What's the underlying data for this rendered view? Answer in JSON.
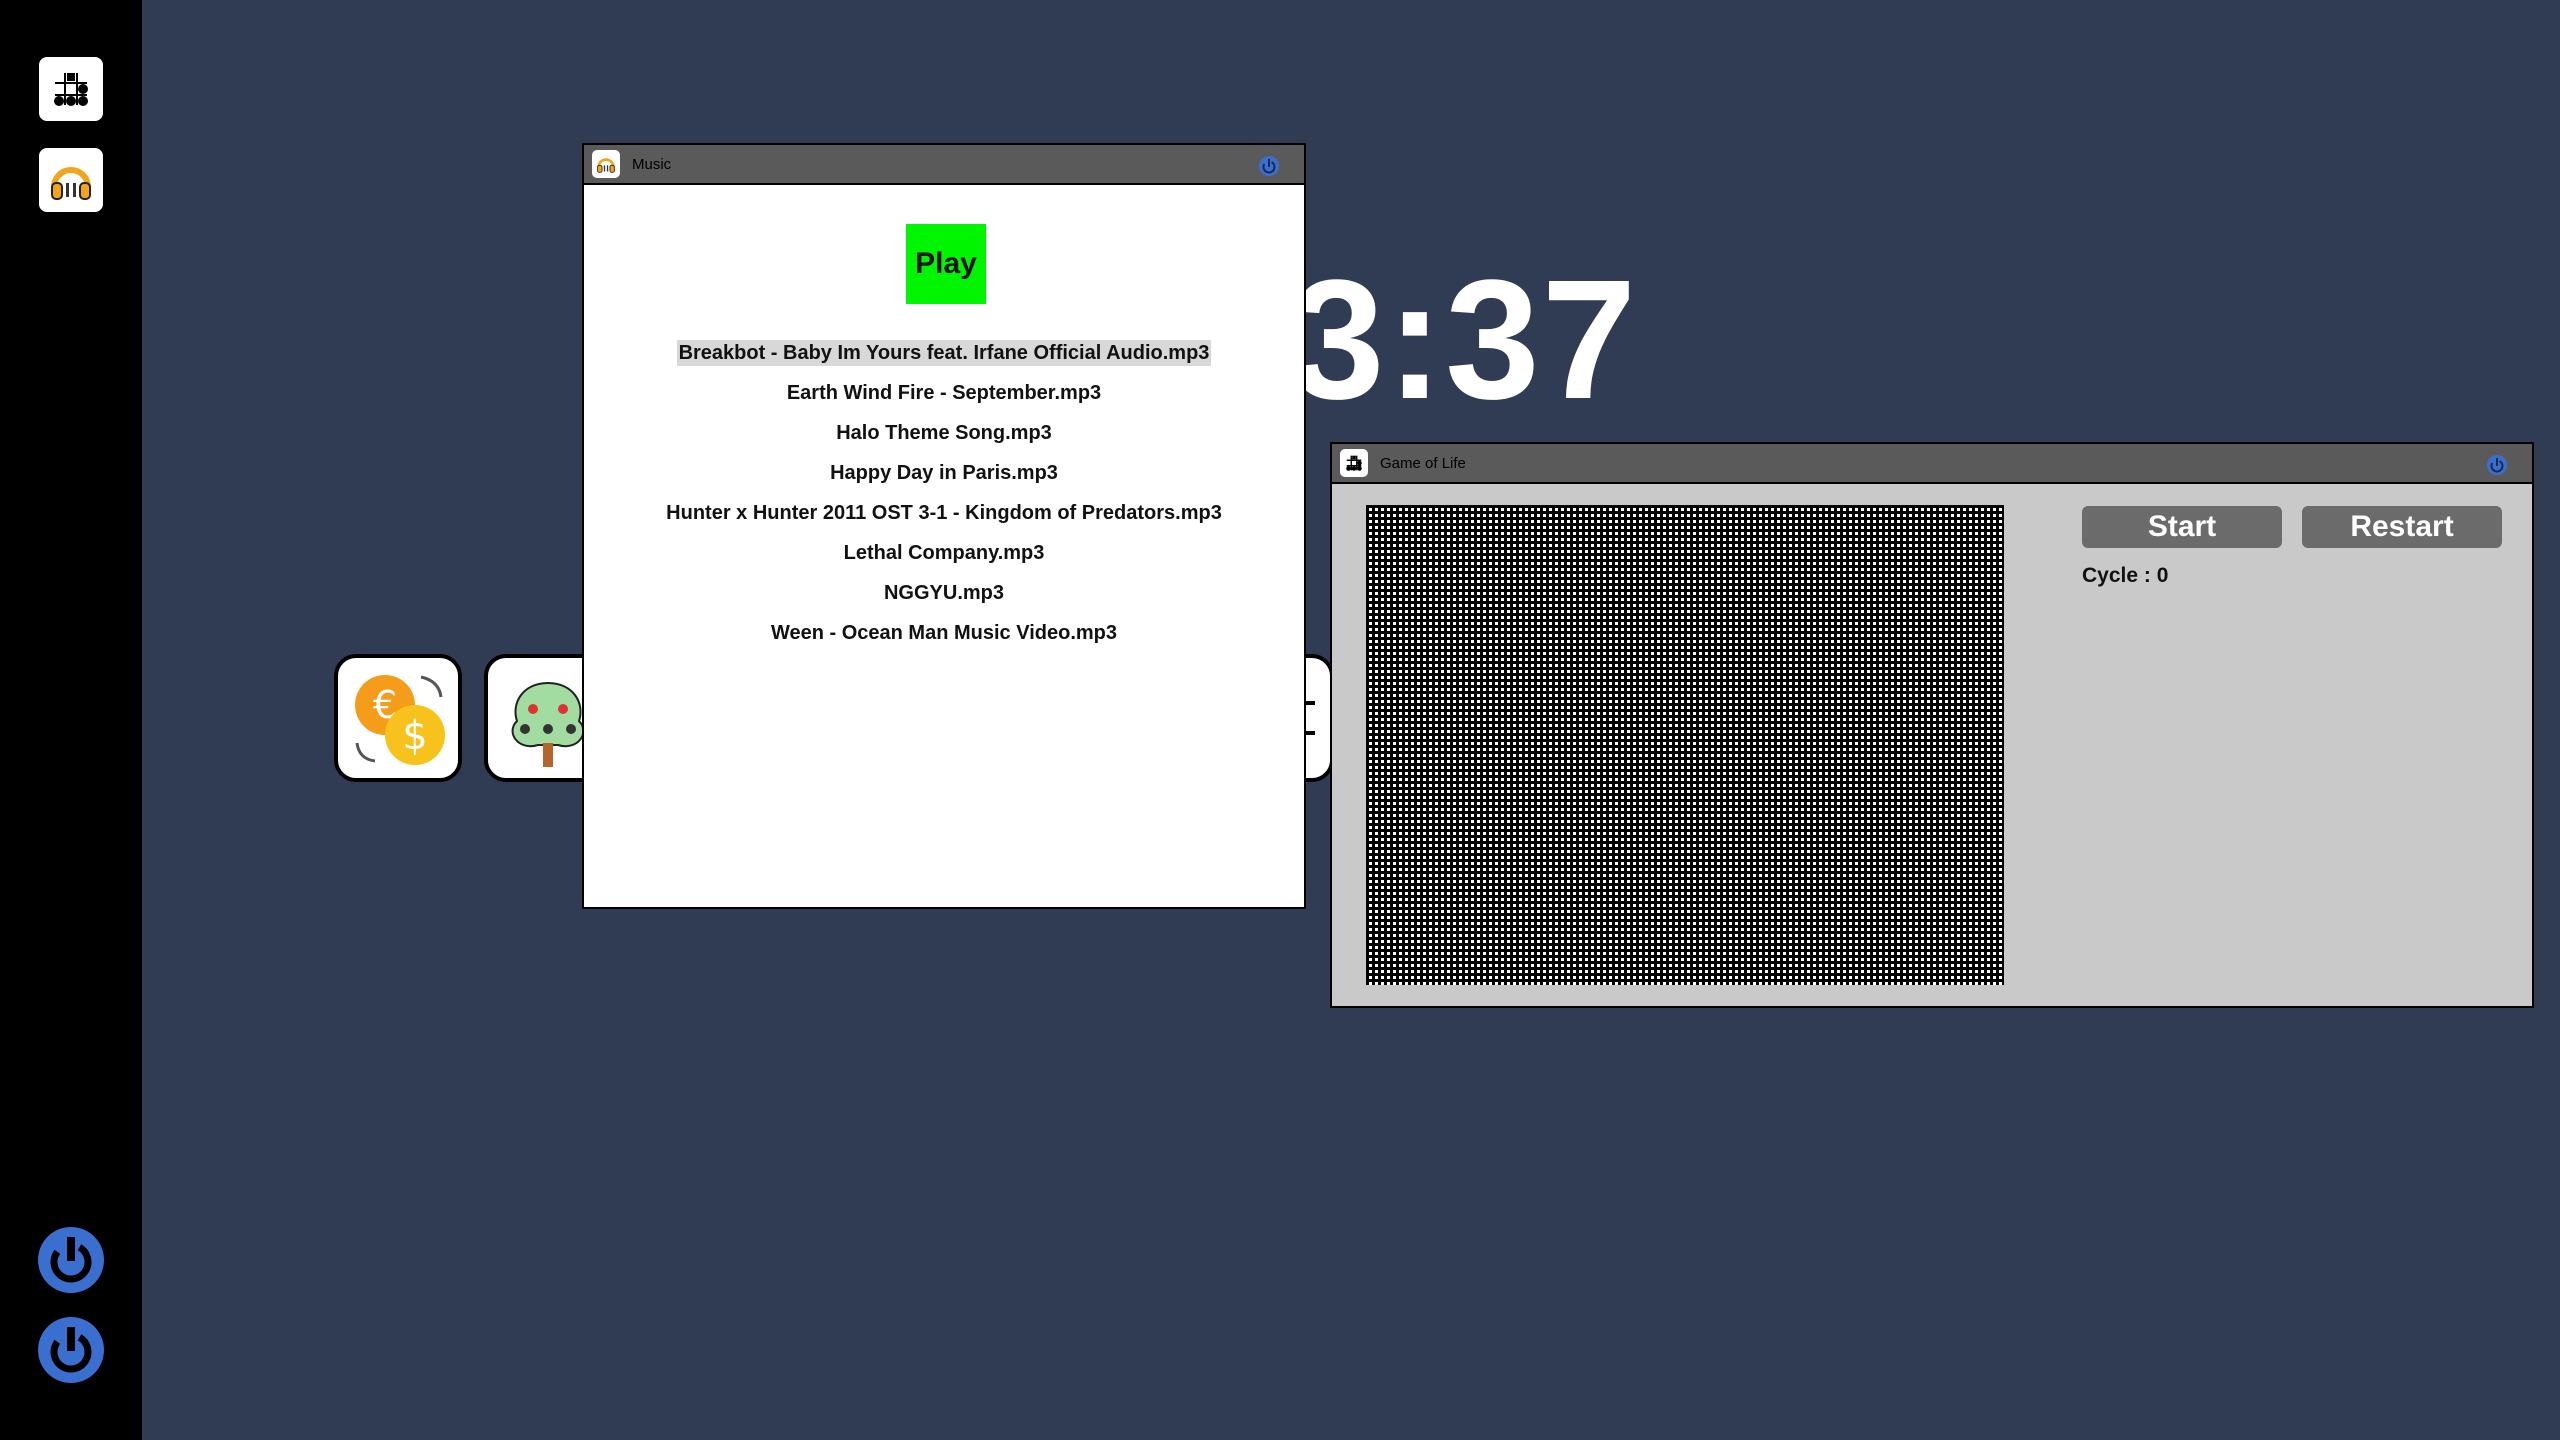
{
  "taskbar": {
    "apps": [
      {
        "icon": "game-of-life-icon"
      },
      {
        "icon": "music-icon"
      }
    ],
    "power_buttons": [
      {
        "icon": "power-icon"
      },
      {
        "icon": "power-icon"
      }
    ]
  },
  "desktop": {
    "clock": "3:37",
    "icons": [
      {
        "icon": "currency-exchange-icon"
      },
      {
        "icon": "family-tree-icon"
      },
      {
        "icon": "tic-tac-toe-icon"
      }
    ]
  },
  "music_window": {
    "title": "Music",
    "play_label": "Play",
    "songs": [
      {
        "name": "Breakbot - Baby Im Yours feat. Irfane Official Audio.mp3",
        "selected": true
      },
      {
        "name": "Earth Wind Fire - September.mp3"
      },
      {
        "name": "Halo Theme Song.mp3"
      },
      {
        "name": "Happy Day in Paris.mp3"
      },
      {
        "name": "Hunter x Hunter 2011 OST 3-1 - Kingdom of Predators.mp3"
      },
      {
        "name": "Lethal Company.mp3"
      },
      {
        "name": "NGGYU.mp3"
      },
      {
        "name": "Ween - Ocean Man Music Video.mp3"
      }
    ]
  },
  "gol_window": {
    "title": "Game of Life",
    "start_label": "Start",
    "restart_label": "Restart",
    "cycle_text": "Cycle : 0"
  },
  "colors": {
    "desktop_bg": "#303b54",
    "play_button": "#00f500",
    "power_blue": "#3a6fd0"
  }
}
